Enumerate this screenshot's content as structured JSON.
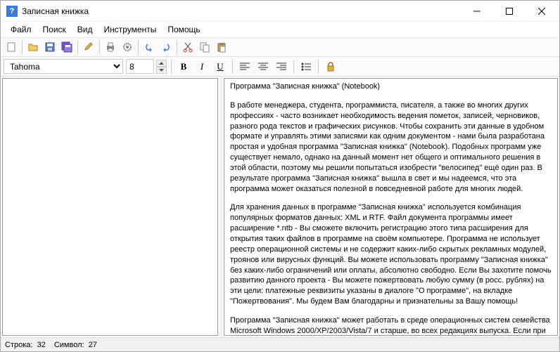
{
  "titlebar": {
    "title": "Записная книжка"
  },
  "menu": {
    "file": "Файл",
    "search": "Поиск",
    "view": "Вид",
    "tools": "Инструменты",
    "help": "Помощь"
  },
  "formatbar": {
    "font": "Tahoma",
    "size": "8"
  },
  "content": {
    "p1": "Программа \"Записная книжка\" (Notebook)",
    "p2": "В работе менеджера, студента, программиста, писателя, а также во многих других профессиях - часто возникает необходимость ведения пометок, записей, черновиков, разного рода текстов и графических рисунков. Чтобы сохранить эти данные в удобном формате и управлять этими записями как одним документом - нами была разработана простая и удобная программа \"Записная книжка\" (Notebook). Подобных программ уже существует немало, однако на данный момент нет общего и оптимального решения в этой области, поэтому мы решили попытаться изобрести \"велосипед\" ещё один раз. В результате программа \"Записная книжка\" вышла в свет и мы надеемся, что эта программа может оказаться полезной в повседневной работе для многих людей.",
    "p3": "Для хранения данных в программе \"Записная книжка\" используется комбинация популярных форматов данных: XML и RTF. Файл документа программы имеет расширение *.ntb - Вы сможете включить регистрацию этого типа расширения для открытия таких файлов в программе на своём компьютере. Программа не использует реестр операционной системы и не содержит каких-либо скрытых рекламных модулей, троянов или вирусных функций. Вы можете использовать программу \"Записная книжка\" без каких-либо ограничений или оплаты, абсолютно свободно. Если Вы захотите помочь развитию данного проекта - Вы можете пожертвовать любую сумму (в росс. рублях) на эти цели: платежные реквизиты указаны в диалоге \"О программе\", на вкладке \"Пожертвования\". Мы будем Вам благодарны и признательны за Вашу помощь!",
    "p4": "Программа \"Записная книжка\" может работать в среде операционных систем семейства Microsoft Windows 2000/XP/2003/Vista/7 и старше, во всех редакциях выпуска. Если при работе программы Вы обнаружите ошибки, проблемы, сбои - просьба сообщить об этом подробно по адресу электронной почты: office@it-minsk.org"
  },
  "status": {
    "line_label": "Строка:",
    "line": "32",
    "char_label": "Символ:",
    "char": "27"
  }
}
